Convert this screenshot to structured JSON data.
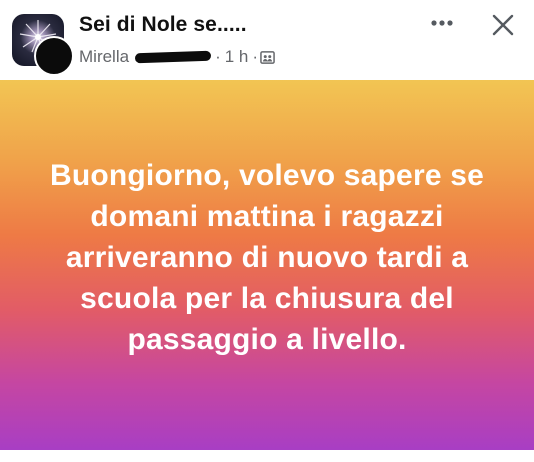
{
  "header": {
    "group_name": "Sei di Nole se.....",
    "author": "Mirella",
    "time": "1 h",
    "separator": "·",
    "audience_icon": "group-icon",
    "more_icon": "more-horizontal-icon",
    "close_icon": "close-icon"
  },
  "post": {
    "message": "Buongiorno, volevo sapere se domani mattina i ragazzi arriveranno di nuovo tardi a scuola per la chiusura del passaggio a livello.",
    "background_colors": [
      "#f2c553",
      "#ee7a45",
      "#e25c66",
      "#a83ec4"
    ]
  },
  "colors": {
    "text_primary": "#111111",
    "text_secondary": "#65676b",
    "post_text": "#ffffff"
  }
}
